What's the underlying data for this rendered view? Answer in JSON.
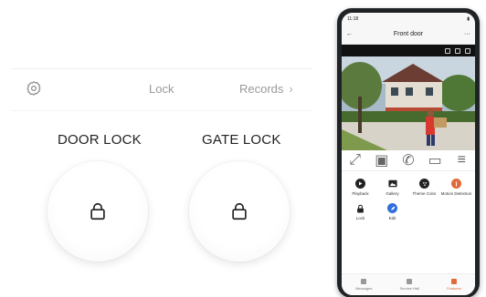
{
  "panel": {
    "tabs": {
      "lock": "Lock",
      "records": "Records"
    },
    "locks": [
      {
        "title": "DOOR LOCK",
        "icon": "padlock-icon"
      },
      {
        "title": "GATE LOCK",
        "icon": "padlock-icon"
      }
    ]
  },
  "phone": {
    "status_time": "11:18",
    "header": {
      "title": "Front door"
    },
    "features": [
      {
        "label": "Playback",
        "color": "#222222",
        "icon": "playback-icon"
      },
      {
        "label": "Gallery",
        "color": "#222222",
        "icon": "gallery-icon"
      },
      {
        "label": "Theme Color",
        "color": "#222222",
        "icon": "palette-icon"
      },
      {
        "label": "Motion Detection",
        "color": "#e06a3a",
        "icon": "motion-icon"
      },
      {
        "label": "Lock",
        "color": "#222222",
        "icon": "lock-icon"
      },
      {
        "label": "Edit",
        "color": "#2f6fde",
        "icon": "edit-icon"
      }
    ],
    "nav": [
      {
        "label": "Messages",
        "active": false
      },
      {
        "label": "Service Hall",
        "active": false
      },
      {
        "label": "Features",
        "active": true
      }
    ]
  },
  "colors": {
    "accent": "#e06a3a",
    "edit_blue": "#2f6fde"
  }
}
